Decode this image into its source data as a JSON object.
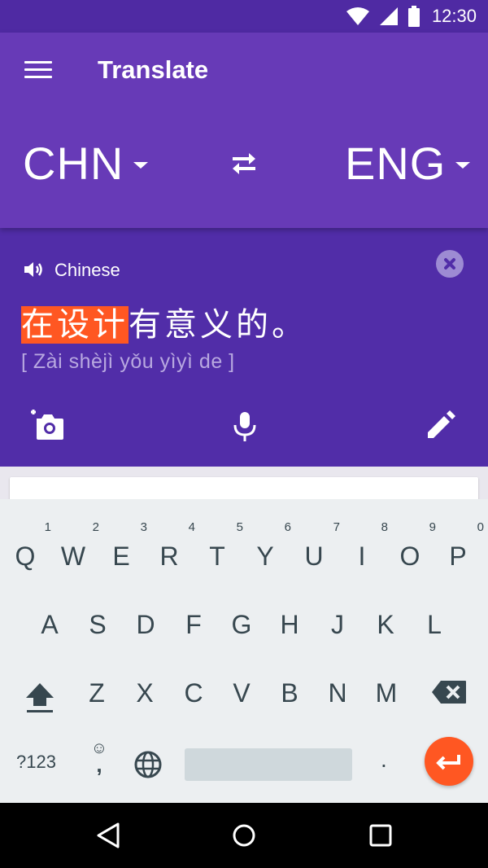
{
  "status_bar": {
    "time": "12:30",
    "icons": [
      "wifi-icon",
      "signal-icon",
      "battery-icon"
    ]
  },
  "app_bar": {
    "title": "Translate",
    "menu_icon": "menu-icon"
  },
  "languages": {
    "source": "CHN",
    "target": "ENG",
    "swap_icon": "swap-arrows-icon"
  },
  "input": {
    "language_label": "Chinese",
    "text_highlighted": "在设计",
    "text_rest": "有意义的。",
    "pinyin": "[ Zài shèjì yǒu yìyì de ]",
    "actions": [
      "camera-icon",
      "mic-icon",
      "edit-icon"
    ]
  },
  "keyboard": {
    "row1": [
      {
        "key": "Q",
        "hint": "1"
      },
      {
        "key": "W",
        "hint": "2"
      },
      {
        "key": "E",
        "hint": "3"
      },
      {
        "key": "R",
        "hint": "4"
      },
      {
        "key": "T",
        "hint": "5"
      },
      {
        "key": "Y",
        "hint": "6"
      },
      {
        "key": "U",
        "hint": "7"
      },
      {
        "key": "I",
        "hint": "8"
      },
      {
        "key": "O",
        "hint": "9"
      },
      {
        "key": "P",
        "hint": "0"
      }
    ],
    "row2": [
      "A",
      "S",
      "D",
      "F",
      "G",
      "H",
      "J",
      "K",
      "L"
    ],
    "row3": [
      "Z",
      "X",
      "C",
      "V",
      "B",
      "N",
      "M"
    ],
    "symbols_label": "?123",
    "emoji_label": "☺",
    "comma_label": ",",
    "period_label": "."
  },
  "colors": {
    "primary": "#673ab7",
    "primary_dark": "#512da8",
    "status_bar": "#4f2aa3",
    "accent": "#ff5722",
    "keyboard_bg": "#eceff1"
  }
}
